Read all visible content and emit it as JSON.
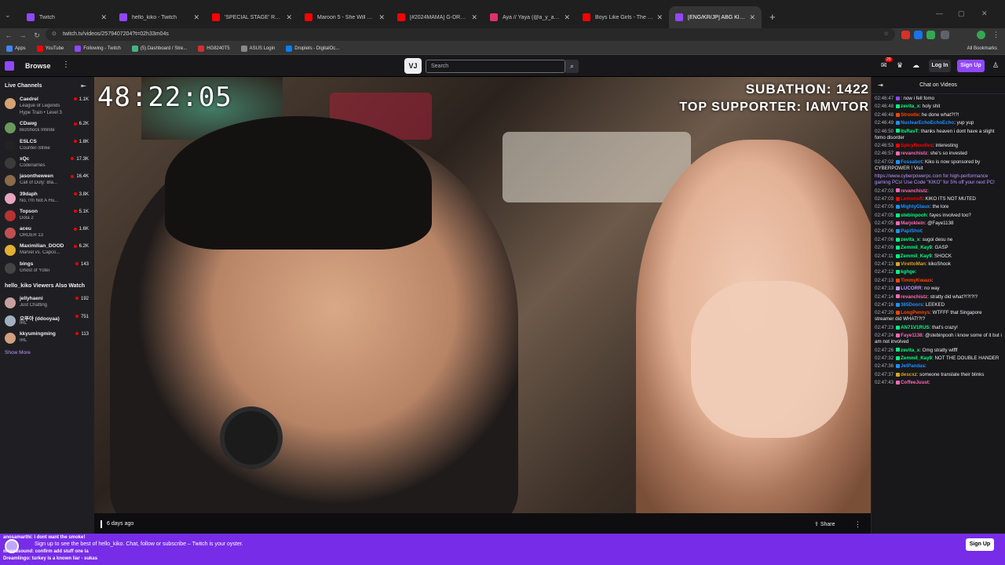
{
  "browser": {
    "tabs": [
      {
        "title": "Twitch",
        "color": "#9147ff"
      },
      {
        "title": "hello_kiko - Twitch",
        "color": "#9147ff"
      },
      {
        "title": "'SPECIAL STAGE' RESCENE - Im",
        "color": "#ff0000"
      },
      {
        "title": "Maroon 5 - She Will Be Loved",
        "color": "#ff0000"
      },
      {
        "title": "[#2024MAMA] G-DRAGON - U",
        "color": "#ff0000"
      },
      {
        "title": "Aya // Yaya (@a_y_a_n_o_) - In",
        "color": "#e1306c"
      },
      {
        "title": "Boys Like Girls - The Great Esca",
        "color": "#ff0000"
      },
      {
        "title": "[ENG/KR/JP] ABG KIKO DAY - T",
        "color": "#9147ff"
      }
    ],
    "active_tab": 7,
    "url": "twitch.tv/videos/2579407204?t=02h33m04s",
    "bookmarks": [
      {
        "label": "Apps",
        "color": "#4285f4"
      },
      {
        "label": "YouTube",
        "color": "#ff0000"
      },
      {
        "label": "Following - Twitch",
        "color": "#9147ff"
      },
      {
        "label": "(5) Dashboard / Stre...",
        "color": "#43b581"
      },
      {
        "label": "HG8240T5",
        "color": "#d32f2f"
      },
      {
        "label": "ASUS Login",
        "color": "#888888"
      },
      {
        "label": "Droplets - DigitalOc...",
        "color": "#0080ff"
      }
    ],
    "all_bookmarks": "All Bookmarks"
  },
  "topnav": {
    "browse": "Browse",
    "search_placeholder": "Search",
    "notif_count": "20",
    "login": "Log In",
    "signup": "Sign Up"
  },
  "sidebar": {
    "live_header": "Live Channels",
    "channels": [
      {
        "name": "Caedrel",
        "game": "League of Legends",
        "viewers": "1.1K",
        "extra": "Hype Train • Level 3",
        "color": "#d4a373"
      },
      {
        "name": "CDawg",
        "game": "BioShock Infinite",
        "viewers": "6.2K",
        "color": "#6a9a5b"
      },
      {
        "name": "ESLCS",
        "game": "Counter-Strike",
        "viewers": "1.8K",
        "color": "#222222"
      },
      {
        "name": "xQc",
        "game": "Codenames",
        "viewers": "17.3K",
        "color": "#3b3b3b"
      },
      {
        "name": "jasontheween",
        "game": "Call of Duty: Bla...",
        "viewers": "16.4K",
        "color": "#8a6a4a"
      },
      {
        "name": "39daph",
        "game": "No, I'm Not A Hu...",
        "viewers": "3.8K",
        "color": "#e6a4c0"
      },
      {
        "name": "Topson",
        "game": "Dota 2",
        "viewers": "5.1K",
        "color": "#b83232"
      },
      {
        "name": "aceu",
        "game": "ORDER 13",
        "viewers": "1.6K",
        "color": "#c05050"
      },
      {
        "name": "Maximilian_DOOD",
        "game": "Marvel vs. Capco...",
        "viewers": "6.2K",
        "color": "#e0b030"
      },
      {
        "name": "bings",
        "game": "Ghost of Yōtei",
        "viewers": "143",
        "color": "#444444"
      }
    ],
    "also_header": "hello_kiko Viewers Also Watch",
    "also": [
      {
        "name": "jellyhaeni",
        "game": "Just Chatting",
        "viewers": "192",
        "color": "#c9a0a0"
      },
      {
        "name": "오뚜아 (ddooyaa)",
        "game": "IRL",
        "viewers": "751",
        "color": "#a0b0c0"
      },
      {
        "name": "kkyumingming",
        "game": "IRL",
        "viewers": "113",
        "color": "#d0a080"
      }
    ],
    "show_more": "Show More"
  },
  "video": {
    "timer": "48:22:05",
    "overlay_line1": "SUBATHON: 1422",
    "overlay_line2": "TOP SUPPORTER: IAMVTOR",
    "ago": "6 days ago",
    "share": "Share"
  },
  "chat": {
    "title": "Chat on Videos",
    "messages": [
      {
        "ts": "02:46:47",
        "user": "",
        "text": ": now i fell fomo",
        "color": "#9147ff"
      },
      {
        "ts": "02:46:48",
        "user": "zevita_x",
        "text": ": holy shit",
        "color": "#00ff7f"
      },
      {
        "ts": "02:46:48",
        "user": "Strootle",
        "text": ": he done what?!?!",
        "color": "#ff4500"
      },
      {
        "ts": "02:46:49",
        "user": "NuclearEchoEchoEcho",
        "text": ": yup yup",
        "color": "#1e90ff"
      },
      {
        "ts": "02:46:50",
        "user": "ItsRavT",
        "text": ": thanks heaven i dont have a slight fomo disorder",
        "color": "#00ff7f"
      },
      {
        "ts": "02:46:53",
        "user": "SplcyNoodles",
        "text": ": interesting",
        "color": "#ff0000"
      },
      {
        "ts": "02:46:57",
        "user": "revanchistz",
        "text": ": she's so invested",
        "color": "#ff69b4"
      },
      {
        "ts": "02:47:02",
        "user": "Fossabot",
        "text": ": Kiko is now sponsored by CYBERPOWER ! Visit",
        "color": "#1e90ff"
      },
      {
        "ts": "",
        "user": "",
        "text": "https://www.cyberpowerpc.com for high-performance gaming PCs! Use Code \"KIKO\" for 5% off your next PC!",
        "color": "#bf94ff",
        "link": true
      },
      {
        "ts": "02:47:03",
        "user": "revanchistz",
        "text": ":",
        "color": "#ff69b4"
      },
      {
        "ts": "02:47:03",
        "user": "Lemonsft",
        "text": ": KIKO ITS NOT MUTED",
        "color": "#ff0000"
      },
      {
        "ts": "02:47:05",
        "user": "MightyGlaux",
        "text": ": the lore",
        "color": "#1e90ff"
      },
      {
        "ts": "02:47:05",
        "user": "stebinpooh",
        "text": ": fayes involved too?",
        "color": "#00ff7f"
      },
      {
        "ts": "02:47:05",
        "user": "Marjoklein",
        "text": ": @Faye1138",
        "color": "#ff69b4"
      },
      {
        "ts": "02:47:06",
        "user": "PapiShot",
        "text": ":",
        "color": "#1e90ff"
      },
      {
        "ts": "02:47:06",
        "user": "zevita_x",
        "text": ": sugoi desu ne",
        "color": "#00ff7f"
      },
      {
        "ts": "02:47:09",
        "user": "Zemmil_Kay9",
        "text": ": GASP",
        "color": "#00ff7f"
      },
      {
        "ts": "02:47:11",
        "user": "Zemmil_Kay9",
        "text": ": SHOCK",
        "color": "#00ff7f"
      },
      {
        "ts": "02:47:13",
        "user": "VirettoMan",
        "text": ": kikoShook",
        "color": "#daa520"
      },
      {
        "ts": "02:47:12",
        "user": "kghge",
        "text": ":",
        "color": "#00ff7f"
      },
      {
        "ts": "02:47:13",
        "user": "TimmyKwaus",
        "text": ":",
        "color": "#ff4500"
      },
      {
        "ts": "02:47:13",
        "user": "LUCORR",
        "text": ": no way",
        "color": "#bf94ff"
      },
      {
        "ts": "02:47:14",
        "user": "revanchistz",
        "text": ": stratty did what?!?!?!?",
        "color": "#ff69b4"
      },
      {
        "ts": "02:47:16",
        "user": "365Doors",
        "text": ": LEEKED",
        "color": "#1e90ff"
      },
      {
        "ts": "02:47:20",
        "user": "LongPennys",
        "text": ": WTFFF that Singapore streamer did WHAT!?!?",
        "color": "#ff4500"
      },
      {
        "ts": "02:47:23",
        "user": "AN71V1RUS",
        "text": ": that's crazy!",
        "color": "#00ff7f"
      },
      {
        "ts": "02:47:24",
        "user": "Faye1138",
        "text": ": @stebinpooh i know some of it but i am not involved",
        "color": "#ff69b4"
      },
      {
        "ts": "02:47:26",
        "user": "zevita_x",
        "text": ": Omg stratty wtfff",
        "color": "#00ff7f"
      },
      {
        "ts": "02:47:32",
        "user": "Zemmil_Kay9",
        "text": ": NOT THE DOUBLE HANDER",
        "color": "#00ff7f"
      },
      {
        "ts": "02:47:36",
        "user": "JetPandas",
        "text": ":",
        "color": "#1e90ff"
      },
      {
        "ts": "02:47:37",
        "user": "descxz",
        "text": ": someone translate their blinks",
        "color": "#daa520"
      },
      {
        "ts": "02:47:43",
        "user": "CoffeeJuust",
        "text": ":",
        "color": "#ff69b4"
      }
    ]
  },
  "banner": {
    "line1": "anosamarthi: i dont want the smoke!",
    "line2": "Sign up to see the best of hello_kiko. Chat, follow or subscribe – Twitch is your oyster.",
    "line3": "maxedsound: confirm add stuff one la",
    "line4": "Dreamlingo: turkey is a known liar - sukas",
    "signup": "Sign Up"
  }
}
